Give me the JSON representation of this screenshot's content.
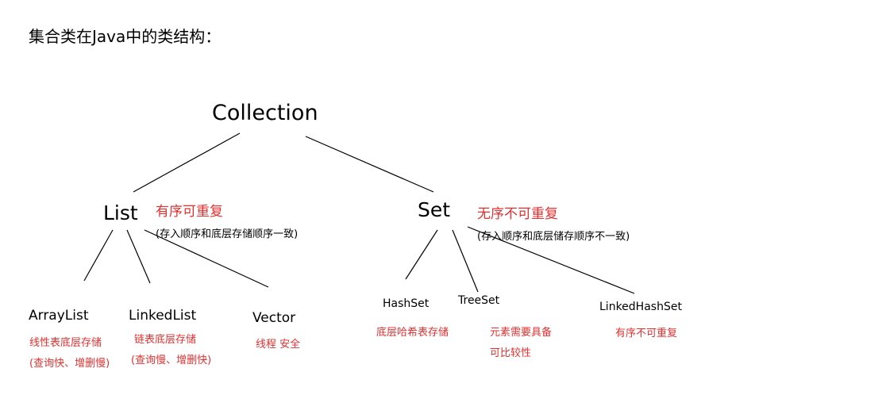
{
  "heading": "集合类在Java中的类结构：",
  "colors": {
    "annotation": "#e03131",
    "text": "#000000",
    "line": "#000000"
  },
  "root": {
    "label": "Collection"
  },
  "list": {
    "label": "List",
    "trait": "有序可重复",
    "note": "(存入顺序和底层存储顺序一致)",
    "children": [
      {
        "label": "ArrayList",
        "desc1": "线性表底层存储",
        "desc2": "(查询快、增删慢)"
      },
      {
        "label": "LinkedList",
        "desc1": "链表底层存储",
        "desc2": "(查询慢、增删快)"
      },
      {
        "label": "Vector",
        "desc1": "线程 安全"
      }
    ]
  },
  "set": {
    "label": "Set",
    "trait": "无序不可重复",
    "note": "(存入顺序和底层储存顺序不一致)",
    "children": [
      {
        "label": "HashSet",
        "desc1": "底层哈希表存储"
      },
      {
        "label": "TreeSet",
        "desc1": "元素需要具备",
        "desc2": "可比较性"
      },
      {
        "label": "LinkedHashSet",
        "desc1": "有序不可重复"
      }
    ]
  }
}
